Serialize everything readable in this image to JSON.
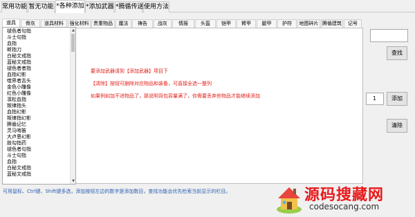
{
  "top_tabs": [
    "常用功能",
    "暂无功能",
    "*各种添加",
    "*添加武器",
    "*腾循传送",
    "使用方法"
  ],
  "sub_tabs": [
    "道具",
    "骨灰",
    "道具材料",
    "强化材料",
    "贵重物品",
    "魔法",
    "祷告",
    "战灰",
    "情报",
    "头盔",
    "铠甲",
    "臂甲",
    "腿甲",
    "护符",
    "地图碎片",
    "腾循建筑",
    "记号"
  ],
  "items": [
    "褪色者句指",
    "斗士句指",
    "血指",
    "断指刀",
    "白秘文戒指",
    "蓝秘文戒指",
    "褪色者者指",
    "血指幻影",
    "噬界者舌头",
    "金色小雕像",
    "红色小雕像",
    "凛松血指",
    "叛律指头",
    "血指幻影",
    "叛律指幻影",
    "腾循记忆",
    "灵马哨笛",
    "大卢恩幻影",
    "肢勾指药",
    "褪色者句指",
    "斗士句指",
    "血指",
    "白秘文戒指",
    "蓝秘文戒指"
  ],
  "messages": [
    "要添加武器请到【添加武器】项目下",
    "【清除】按钮可删除对应物品和装备，可直接全选一整列",
    "如果例如加不进物品了，那说明背包容量满了，你需要丢弃些物品才能继续添加"
  ],
  "buttons": {
    "search": "查找",
    "add": "添加",
    "clear": "清除"
  },
  "search_value": "",
  "quantity": "1",
  "status": "可用鼠标、Ctrl键、Shift键多选，添加按钮左边的数字是添加数目，查找功能会优先检索当前显示的栏目。",
  "watermark": {
    "title": "源码搜藏网",
    "url": "codesocang.com"
  },
  "colors": {
    "message": "#e0201a",
    "status": "#2b5fb0",
    "watermark": "#e8191b"
  }
}
